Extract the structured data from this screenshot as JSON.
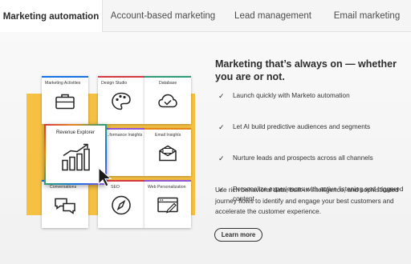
{
  "tabs": [
    {
      "label": "Marketing automation",
      "active": true
    },
    {
      "label": "Account-based marketing",
      "active": false
    },
    {
      "label": "Lead management",
      "active": false
    },
    {
      "label": "Email marketing",
      "active": false
    }
  ],
  "illustration": {
    "cards": [
      {
        "label": "Marketing Activities",
        "accent": "#1473e6",
        "icon": "briefcase-icon"
      },
      {
        "label": "Design Studio",
        "accent": "#d7373f",
        "icon": "palette-icon"
      },
      {
        "label": "Database",
        "accent": "#2d9d78",
        "icon": "cloud-check-icon"
      },
      {
        "label": "...formance Insights",
        "accent": "#9256d9",
        "icon": "chart-icon"
      },
      {
        "label": "Email Insights",
        "accent": "#e68619",
        "icon": "envelope-icon"
      },
      {
        "label": "Conversations",
        "accent": "#1473e6",
        "icon": "chat-icon"
      },
      {
        "label": "SEO",
        "accent": "#d7373f",
        "icon": "compass-icon"
      },
      {
        "label": "Web Personalization",
        "accent": "#9256d9",
        "icon": "browser-icon"
      }
    ],
    "featured": {
      "label": "Revenue Explorer",
      "icon": "bar-chart-trend-icon"
    },
    "background_color": "#f6c143"
  },
  "content": {
    "heading": "Marketing that’s always on — whether you are or not.",
    "bullets": [
      "Launch quickly with Marketo automation",
      "Let AI build predictive audiences and segments",
      "Nurture leads and prospects across all channels",
      "Personalize experiences with active listening and triggered content"
    ],
    "paragraph": "Use rich behavioral data, built-in intelligence, and sophisticated journey flows to identify and engage your best customers and accelerate the customer experience.",
    "cta_label": "Learn more"
  }
}
